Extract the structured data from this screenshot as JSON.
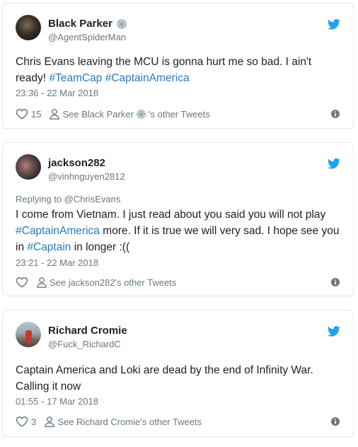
{
  "tweets": [
    {
      "name": "Black Parker",
      "name_icon": "spider-web-icon",
      "handle": "@AgentSpiderMan",
      "text_parts": [
        "Chris Evans leaving the MCU is gonna hurt me so bad. I ain't ready! ",
        "#TeamCap",
        " ",
        "#CaptainAmerica"
      ],
      "time": "23:36 - 22 Mar 2018",
      "likes": "15",
      "more_link": [
        "See Black Parker ",
        "'s other Tweets"
      ]
    },
    {
      "name": "jackson282",
      "handle": "@vinhnguyen2812",
      "replying_prefix": "Replying to ",
      "replying_to": "@ChrisEvans",
      "text_parts": [
        "I come from Vietnam. I just read about you said you will not play ",
        "#CaptainAmerica",
        " more. If it is true we will very sad. I hope see you in ",
        "#Captain",
        " in longer :(("
      ],
      "time": "23:21 - 22 Mar 2018",
      "likes": "",
      "more_link": "See jackson282's other Tweets"
    },
    {
      "name": "Richard Cromie",
      "handle": "@Fuck_RichardC",
      "text_parts": [
        "Captain America and Loki are dead by the end of Infinity War. Calling it now"
      ],
      "time": "01:55 - 17 Mar 2018",
      "likes": "3",
      "more_link": "See Richard Cromie's other Tweets"
    }
  ],
  "colors": {
    "accent": "#1da1f2",
    "link": "#2b7bb9",
    "muted": "#697882",
    "border": "#e1e8ed"
  }
}
